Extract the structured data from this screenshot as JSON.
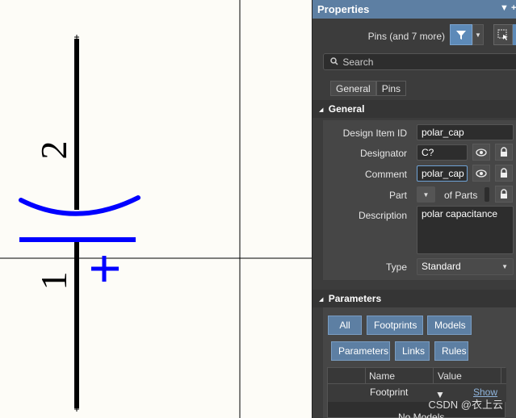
{
  "schematic": {
    "pin_top_number": "2",
    "pin_bottom_number": "1",
    "plus_sign": "+",
    "colors": {
      "wire": "#000000",
      "symbol": "#0000ff",
      "background": "#fdfcf7",
      "crosshair": "#000000"
    }
  },
  "panel": {
    "title": "Properties",
    "filter_text": "Pins (and 7 more)",
    "search_placeholder": "Search",
    "tabs": [
      {
        "label": "General"
      },
      {
        "label": "Pins"
      }
    ],
    "general": {
      "header": "General",
      "design_item_id": {
        "label": "Design Item ID",
        "value": "polar_cap"
      },
      "designator": {
        "label": "Designator",
        "value": "C?"
      },
      "comment": {
        "label": "Comment",
        "value": "polar_cap"
      },
      "part": {
        "label": "Part",
        "of_parts": "of Parts"
      },
      "description": {
        "label": "Description",
        "value": "polar capacitance"
      },
      "type": {
        "label": "Type",
        "value": "Standard"
      }
    },
    "parameters": {
      "header": "Parameters",
      "buttons_row1": [
        "All",
        "Footprints",
        "Models"
      ],
      "buttons_row2": [
        "Parameters",
        "Links",
        "Rules"
      ],
      "table": {
        "columns": [
          "Name",
          "Value"
        ],
        "row": {
          "name": "Footprint",
          "show": "Show"
        },
        "partial_row": "No Models"
      }
    },
    "accent_color": "#5d7fa3"
  },
  "watermark": "CSDN @衣上云"
}
